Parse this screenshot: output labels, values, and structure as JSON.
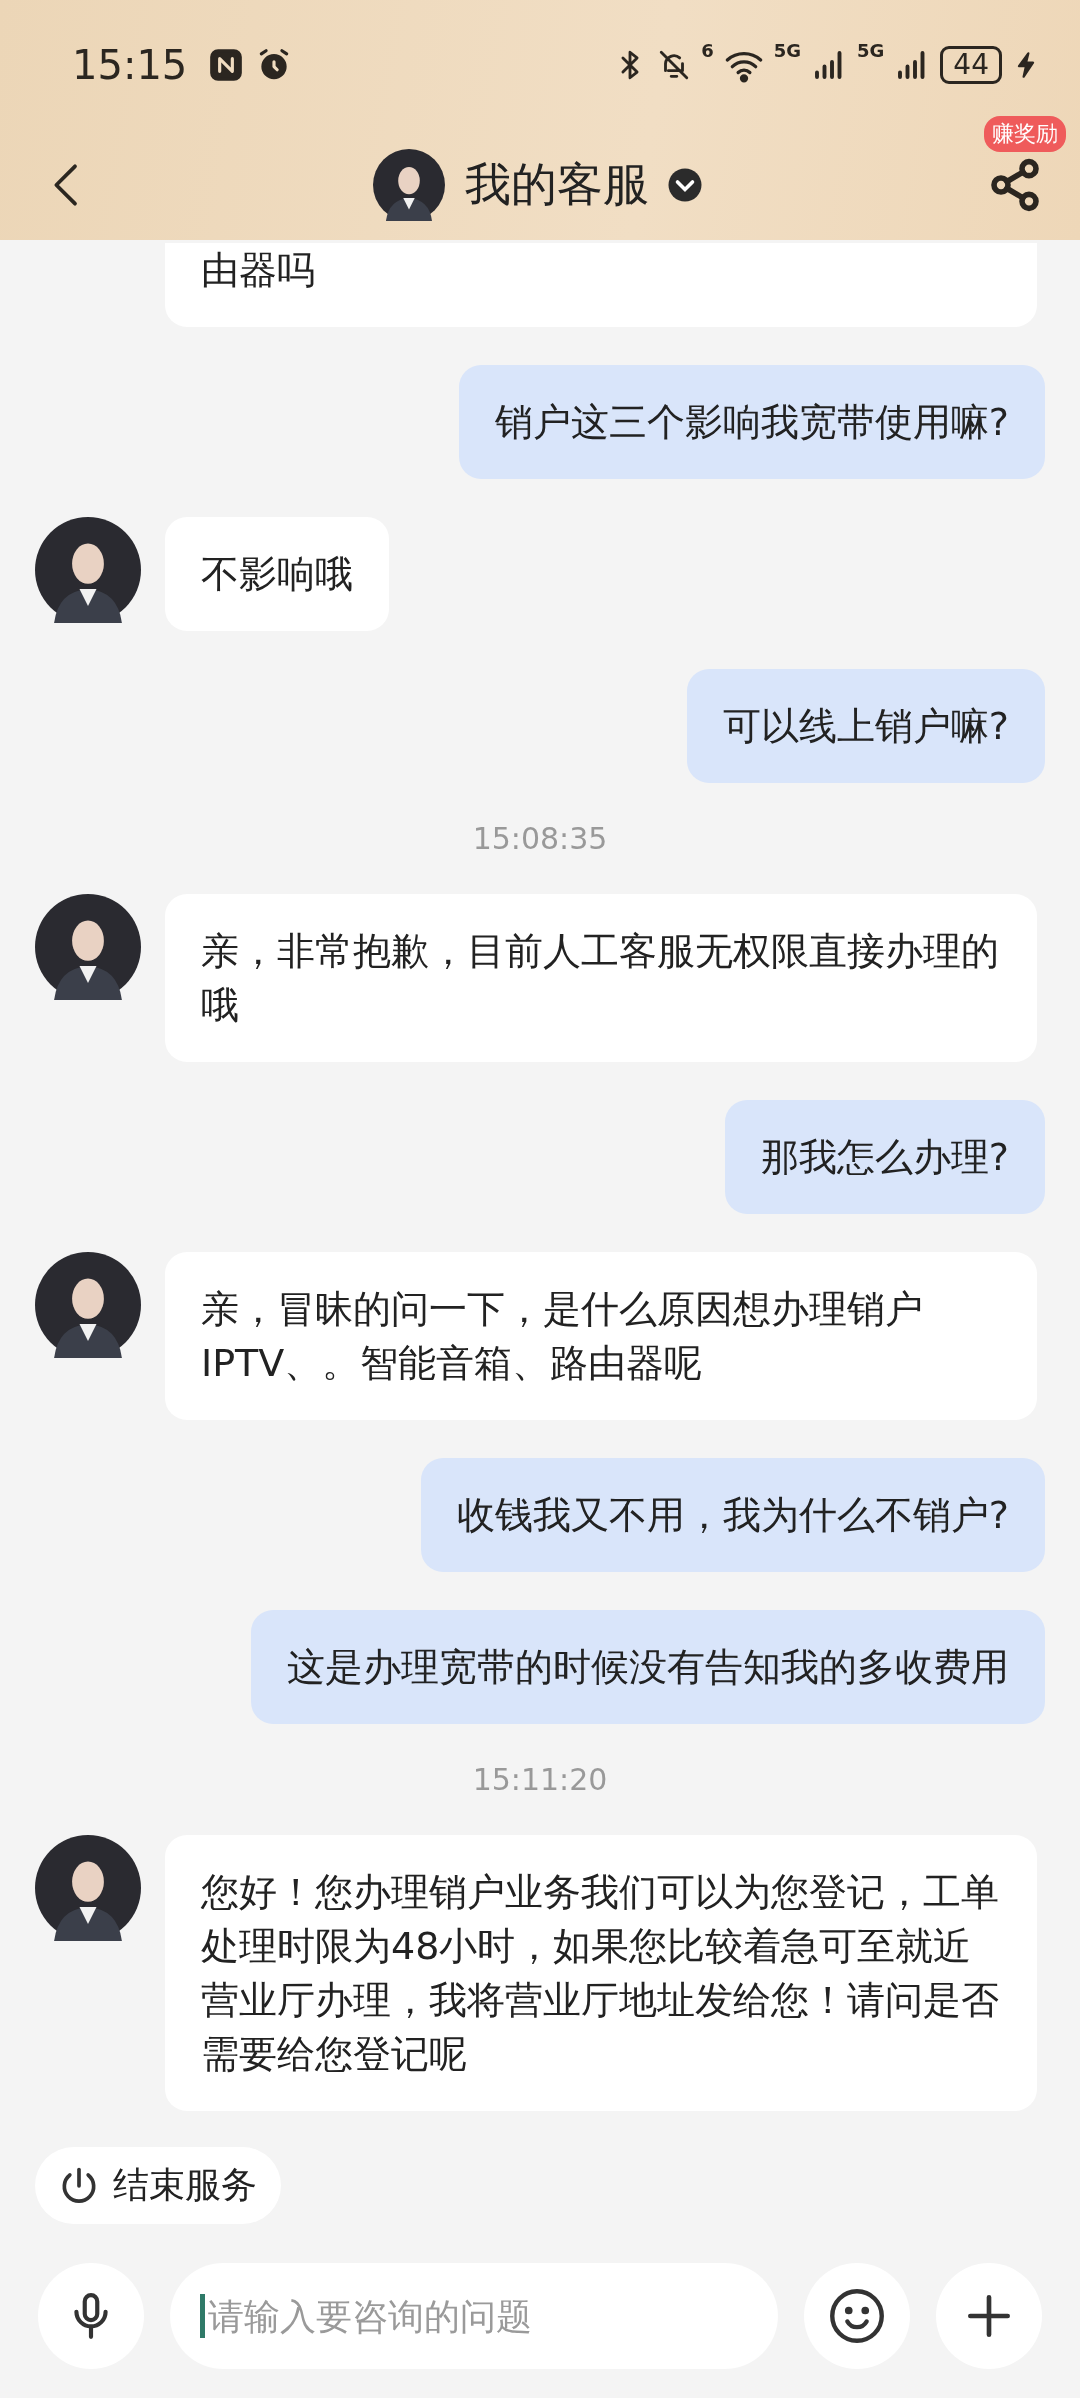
{
  "status_bar": {
    "time": "15:15",
    "wifi_label": "6",
    "sim1_label": "5G",
    "sim2_label": "5G",
    "battery": "44"
  },
  "header": {
    "title": "我的客服",
    "badge": "赚奖励"
  },
  "messages": [
    {
      "kind": "agent",
      "text": "由器吗",
      "cut": true
    },
    {
      "kind": "user",
      "text": "销户这三个影响我宽带使用嘛?"
    },
    {
      "kind": "agent",
      "text": "不影响哦"
    },
    {
      "kind": "user",
      "text": "可以线上销户嘛?"
    },
    {
      "kind": "time",
      "text": "15:08:35"
    },
    {
      "kind": "agent",
      "text": "亲，非常抱歉，目前人工客服无权限直接办理的哦"
    },
    {
      "kind": "user",
      "text": "那我怎么办理?"
    },
    {
      "kind": "agent",
      "text": "亲，冒昧的问一下，是什么原因想办理销户IPTV、。智能音箱、路由器呢"
    },
    {
      "kind": "user",
      "text": "收钱我又不用，我为什么不销户?"
    },
    {
      "kind": "user",
      "text": "这是办理宽带的时候没有告知我的多收费用"
    },
    {
      "kind": "time",
      "text": "15:11:20"
    },
    {
      "kind": "agent",
      "text": "您好！您办理销户业务我们可以为您登记，工单处理时限为48小时，如果您比较着急可至就近营业厅办理，我将营业厅地址发给您！请问是否需要给您登记呢"
    }
  ],
  "end_service": "结束服务",
  "input": {
    "placeholder": "请输入要咨询的问题"
  }
}
